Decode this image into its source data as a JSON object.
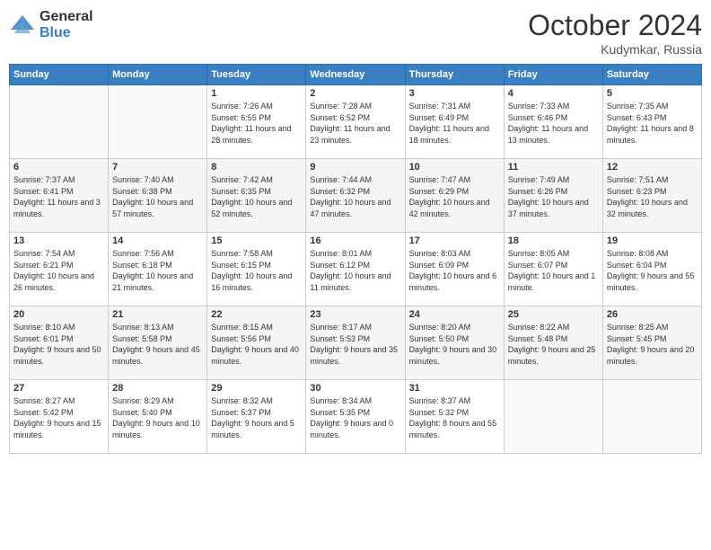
{
  "logo": {
    "general": "General",
    "blue": "Blue"
  },
  "header": {
    "month": "October 2024",
    "location": "Kudymkar, Russia"
  },
  "days_of_week": [
    "Sunday",
    "Monday",
    "Tuesday",
    "Wednesday",
    "Thursday",
    "Friday",
    "Saturday"
  ],
  "weeks": [
    [
      {
        "day": "",
        "sunrise": "",
        "sunset": "",
        "daylight": ""
      },
      {
        "day": "",
        "sunrise": "",
        "sunset": "",
        "daylight": ""
      },
      {
        "day": "1",
        "sunrise": "Sunrise: 7:26 AM",
        "sunset": "Sunset: 6:55 PM",
        "daylight": "Daylight: 11 hours and 28 minutes."
      },
      {
        "day": "2",
        "sunrise": "Sunrise: 7:28 AM",
        "sunset": "Sunset: 6:52 PM",
        "daylight": "Daylight: 11 hours and 23 minutes."
      },
      {
        "day": "3",
        "sunrise": "Sunrise: 7:31 AM",
        "sunset": "Sunset: 6:49 PM",
        "daylight": "Daylight: 11 hours and 18 minutes."
      },
      {
        "day": "4",
        "sunrise": "Sunrise: 7:33 AM",
        "sunset": "Sunset: 6:46 PM",
        "daylight": "Daylight: 11 hours and 13 minutes."
      },
      {
        "day": "5",
        "sunrise": "Sunrise: 7:35 AM",
        "sunset": "Sunset: 6:43 PM",
        "daylight": "Daylight: 11 hours and 8 minutes."
      }
    ],
    [
      {
        "day": "6",
        "sunrise": "Sunrise: 7:37 AM",
        "sunset": "Sunset: 6:41 PM",
        "daylight": "Daylight: 11 hours and 3 minutes."
      },
      {
        "day": "7",
        "sunrise": "Sunrise: 7:40 AM",
        "sunset": "Sunset: 6:38 PM",
        "daylight": "Daylight: 10 hours and 57 minutes."
      },
      {
        "day": "8",
        "sunrise": "Sunrise: 7:42 AM",
        "sunset": "Sunset: 6:35 PM",
        "daylight": "Daylight: 10 hours and 52 minutes."
      },
      {
        "day": "9",
        "sunrise": "Sunrise: 7:44 AM",
        "sunset": "Sunset: 6:32 PM",
        "daylight": "Daylight: 10 hours and 47 minutes."
      },
      {
        "day": "10",
        "sunrise": "Sunrise: 7:47 AM",
        "sunset": "Sunset: 6:29 PM",
        "daylight": "Daylight: 10 hours and 42 minutes."
      },
      {
        "day": "11",
        "sunrise": "Sunrise: 7:49 AM",
        "sunset": "Sunset: 6:26 PM",
        "daylight": "Daylight: 10 hours and 37 minutes."
      },
      {
        "day": "12",
        "sunrise": "Sunrise: 7:51 AM",
        "sunset": "Sunset: 6:23 PM",
        "daylight": "Daylight: 10 hours and 32 minutes."
      }
    ],
    [
      {
        "day": "13",
        "sunrise": "Sunrise: 7:54 AM",
        "sunset": "Sunset: 6:21 PM",
        "daylight": "Daylight: 10 hours and 26 minutes."
      },
      {
        "day": "14",
        "sunrise": "Sunrise: 7:56 AM",
        "sunset": "Sunset: 6:18 PM",
        "daylight": "Daylight: 10 hours and 21 minutes."
      },
      {
        "day": "15",
        "sunrise": "Sunrise: 7:58 AM",
        "sunset": "Sunset: 6:15 PM",
        "daylight": "Daylight: 10 hours and 16 minutes."
      },
      {
        "day": "16",
        "sunrise": "Sunrise: 8:01 AM",
        "sunset": "Sunset: 6:12 PM",
        "daylight": "Daylight: 10 hours and 11 minutes."
      },
      {
        "day": "17",
        "sunrise": "Sunrise: 8:03 AM",
        "sunset": "Sunset: 6:09 PM",
        "daylight": "Daylight: 10 hours and 6 minutes."
      },
      {
        "day": "18",
        "sunrise": "Sunrise: 8:05 AM",
        "sunset": "Sunset: 6:07 PM",
        "daylight": "Daylight: 10 hours and 1 minute."
      },
      {
        "day": "19",
        "sunrise": "Sunrise: 8:08 AM",
        "sunset": "Sunset: 6:04 PM",
        "daylight": "Daylight: 9 hours and 55 minutes."
      }
    ],
    [
      {
        "day": "20",
        "sunrise": "Sunrise: 8:10 AM",
        "sunset": "Sunset: 6:01 PM",
        "daylight": "Daylight: 9 hours and 50 minutes."
      },
      {
        "day": "21",
        "sunrise": "Sunrise: 8:13 AM",
        "sunset": "Sunset: 5:58 PM",
        "daylight": "Daylight: 9 hours and 45 minutes."
      },
      {
        "day": "22",
        "sunrise": "Sunrise: 8:15 AM",
        "sunset": "Sunset: 5:56 PM",
        "daylight": "Daylight: 9 hours and 40 minutes."
      },
      {
        "day": "23",
        "sunrise": "Sunrise: 8:17 AM",
        "sunset": "Sunset: 5:53 PM",
        "daylight": "Daylight: 9 hours and 35 minutes."
      },
      {
        "day": "24",
        "sunrise": "Sunrise: 8:20 AM",
        "sunset": "Sunset: 5:50 PM",
        "daylight": "Daylight: 9 hours and 30 minutes."
      },
      {
        "day": "25",
        "sunrise": "Sunrise: 8:22 AM",
        "sunset": "Sunset: 5:48 PM",
        "daylight": "Daylight: 9 hours and 25 minutes."
      },
      {
        "day": "26",
        "sunrise": "Sunrise: 8:25 AM",
        "sunset": "Sunset: 5:45 PM",
        "daylight": "Daylight: 9 hours and 20 minutes."
      }
    ],
    [
      {
        "day": "27",
        "sunrise": "Sunrise: 8:27 AM",
        "sunset": "Sunset: 5:42 PM",
        "daylight": "Daylight: 9 hours and 15 minutes."
      },
      {
        "day": "28",
        "sunrise": "Sunrise: 8:29 AM",
        "sunset": "Sunset: 5:40 PM",
        "daylight": "Daylight: 9 hours and 10 minutes."
      },
      {
        "day": "29",
        "sunrise": "Sunrise: 8:32 AM",
        "sunset": "Sunset: 5:37 PM",
        "daylight": "Daylight: 9 hours and 5 minutes."
      },
      {
        "day": "30",
        "sunrise": "Sunrise: 8:34 AM",
        "sunset": "Sunset: 5:35 PM",
        "daylight": "Daylight: 9 hours and 0 minutes."
      },
      {
        "day": "31",
        "sunrise": "Sunrise: 8:37 AM",
        "sunset": "Sunset: 5:32 PM",
        "daylight": "Daylight: 8 hours and 55 minutes."
      },
      {
        "day": "",
        "sunrise": "",
        "sunset": "",
        "daylight": ""
      },
      {
        "day": "",
        "sunrise": "",
        "sunset": "",
        "daylight": ""
      }
    ]
  ]
}
